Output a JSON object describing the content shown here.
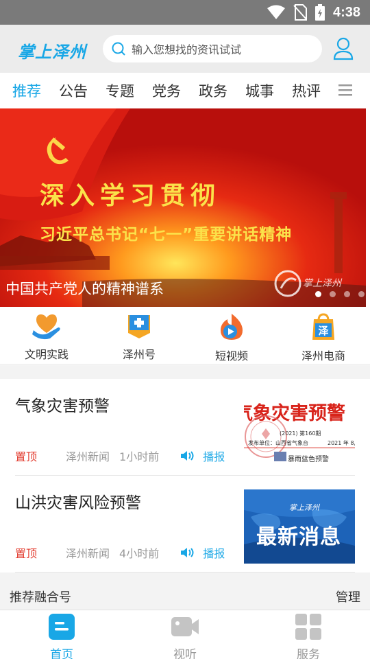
{
  "status_bar": {
    "time": "4:38"
  },
  "header": {
    "logo": "掌上泽州",
    "search_placeholder": "输入您想找的资讯试试"
  },
  "tabs": [
    "推荐",
    "公告",
    "专题",
    "党务",
    "政务",
    "城事",
    "热评"
  ],
  "banner": {
    "headline": "深入学习贯彻",
    "subline": "习近平总书记“七一”重要讲话精神",
    "caption": "中国共产党人的精神谱系",
    "watermark": "掌上泽州",
    "dots_total": 4,
    "dots_active": 1
  },
  "quick_links": [
    {
      "label": "文明实践",
      "icon": "heart-hand-icon",
      "color": "#f29a2e"
    },
    {
      "label": "泽州号",
      "icon": "plus-badge-icon",
      "color": "#2a8fe0"
    },
    {
      "label": "短视频",
      "icon": "video-flame-icon",
      "color": "#f26b2e"
    },
    {
      "label": "泽州电商",
      "icon": "shopping-bag-icon",
      "color": "#f5a623"
    }
  ],
  "articles": [
    {
      "title": "气象灾害预警",
      "pin": "置顶",
      "source": "泽州新闻",
      "time": "1小时前",
      "play_label": "播报",
      "thumb": {
        "heading": "气象灾害预警",
        "line1": "(2021) 第160期",
        "line2": "发布单位：山西省气象台",
        "line3": "2021 年 8月",
        "bottom": "暴雨蓝色预警",
        "seal": "山西省气象台"
      }
    },
    {
      "title": "山洪灾害风险预警",
      "pin": "置顶",
      "source": "泽州新闻",
      "time": "4小时前",
      "play_label": "播报",
      "thumb": {
        "logo": "掌上泽州",
        "heading": "最新消息"
      }
    }
  ],
  "recommend_bar": {
    "title": "推荐融合号",
    "manage": "管理"
  },
  "bottom_nav": [
    {
      "label": "首页",
      "active": true
    },
    {
      "label": "视听",
      "active": false
    },
    {
      "label": "服务",
      "active": false
    }
  ],
  "colors": {
    "accent": "#19a7e6",
    "pin": "#e23b2e",
    "banner_red": "#c8160f",
    "gold": "#fbe24a"
  }
}
